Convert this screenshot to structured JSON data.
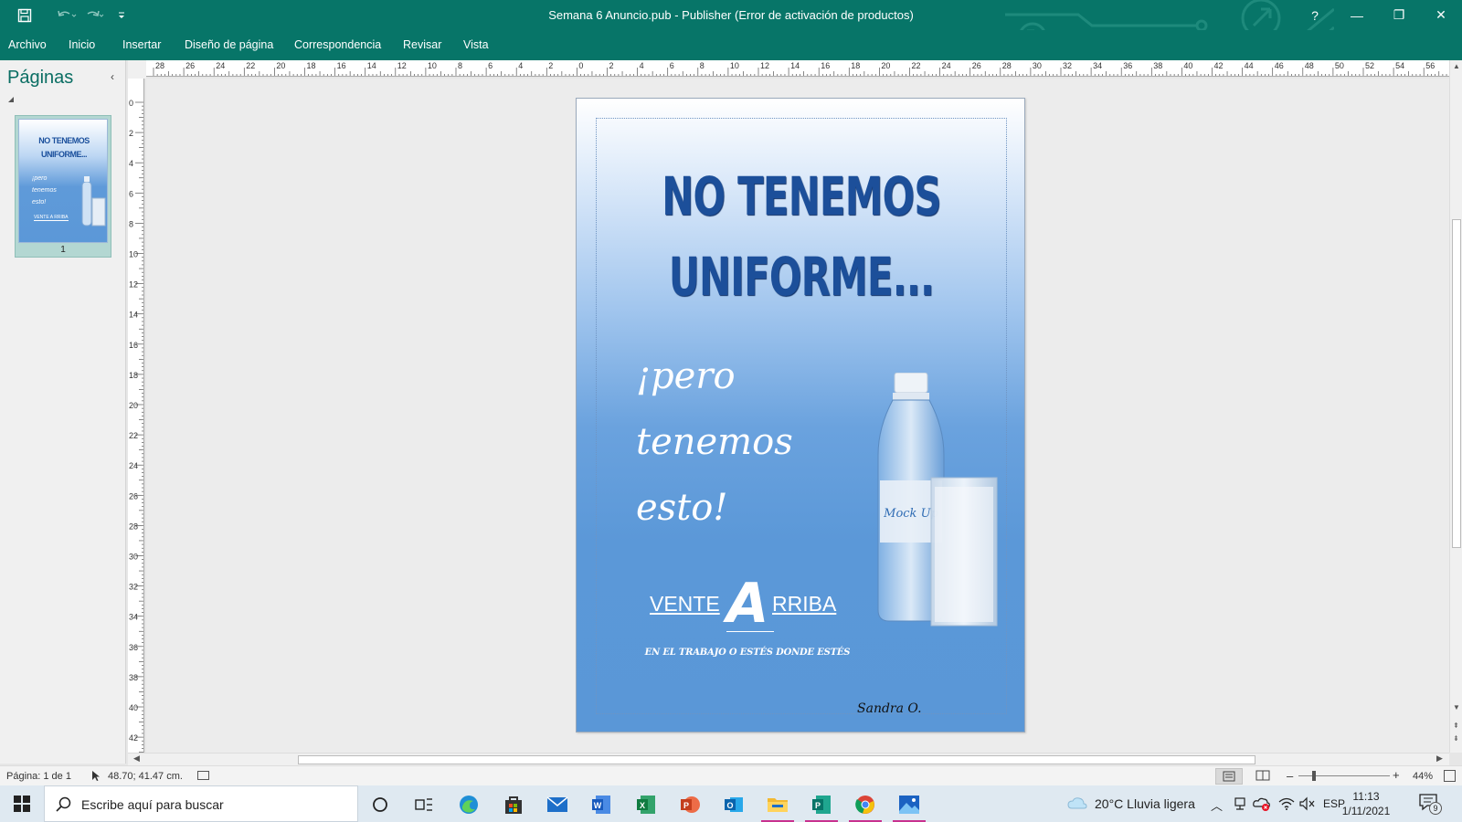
{
  "window": {
    "title": "Semana 6 Anuncio.pub - Publisher (Error de activación de productos)",
    "controls": {
      "help": "?",
      "minimize": "—",
      "restore": "❐",
      "close": "✕"
    }
  },
  "ribbon": {
    "tabs": [
      "Archivo",
      "Inicio",
      "Insertar",
      "Diseño de página",
      "Correspondencia",
      "Revisar",
      "Vista"
    ]
  },
  "pages_pane": {
    "title": "Páginas",
    "collapse": "‹",
    "thumbnail": {
      "page_number": "1",
      "headline": [
        "NO TENEMOS",
        "UNIFORME..."
      ],
      "script": [
        "¡pero",
        "tenemos",
        "esto!"
      ],
      "footer": "VENTE A RRIBA"
    }
  },
  "rulers": {
    "horizontal": [
      "28",
      "26",
      "24",
      "22",
      "20",
      "18",
      "16",
      "14",
      "12",
      "10",
      "8",
      "6",
      "4",
      "2",
      "0",
      "2",
      "4",
      "6",
      "8",
      "10",
      "12",
      "14",
      "16",
      "18",
      "20",
      "22",
      "24",
      "26",
      "28",
      "30",
      "32",
      "34",
      "36",
      "38",
      "40",
      "42",
      "44",
      "46",
      "48",
      "50",
      "52",
      "54",
      "56"
    ],
    "vertical": [
      "0",
      "2",
      "4",
      "6",
      "8",
      "10",
      "12",
      "14",
      "16",
      "18",
      "20",
      "22",
      "24",
      "26",
      "28",
      "30",
      "32",
      "34",
      "36",
      "38",
      "40",
      "42"
    ]
  },
  "document": {
    "headline": [
      "NO TENEMOS",
      "UNIFORME..."
    ],
    "script": [
      "¡pero",
      "tenemos",
      "esto!"
    ],
    "vente": {
      "left": "VENTE",
      "letter": "A",
      "right": "RRIBA"
    },
    "tagline": "EN EL TRABAJO O  ESTÉS DONDE ESTÉS",
    "signature": "Sandra O.",
    "bottle_label": "Mock Up"
  },
  "statusbar": {
    "page": "Página: 1 de 1",
    "coords": "48.70; 41.47 cm.",
    "zoom": "44%",
    "zoom_minus": "–",
    "zoom_plus": "+"
  },
  "taskbar": {
    "search_placeholder": "Escribe aquí para buscar",
    "weather": "20°C  Lluvia ligera",
    "language": "ESP",
    "time": "11:13",
    "date": "1/11/2021",
    "notifications": "9"
  },
  "colors": {
    "accent": "#077568",
    "headline": "#1c4f9a",
    "page_blue": "#5b98d8"
  }
}
